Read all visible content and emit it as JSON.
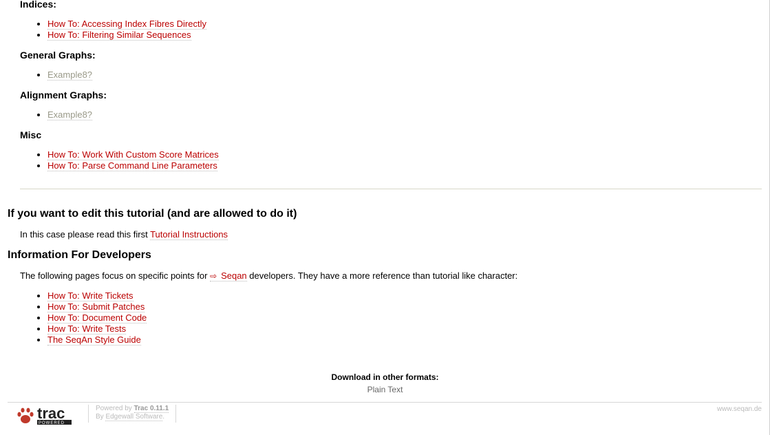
{
  "sections": {
    "indices": {
      "heading": "Indices:",
      "links": [
        "How To: Accessing Index Fibres Directly",
        "How To: Filtering Similar Sequences"
      ]
    },
    "general_graphs": {
      "heading": "General Graphs:",
      "links": [
        "Example8?"
      ]
    },
    "alignment_graphs": {
      "heading": "Alignment Graphs:",
      "links": [
        "Example8?"
      ]
    },
    "misc": {
      "heading": "Misc",
      "links": [
        "How To: Work With Custom Score Matrices",
        "How To: Parse Command Line Parameters"
      ]
    }
  },
  "edit": {
    "heading": "If you want to edit this tutorial (and are allowed to do it)",
    "text": "In this case please read this first",
    "link": "Tutorial Instructions"
  },
  "developers": {
    "heading": "Information For Developers",
    "text_before": "The following pages focus on specific points for",
    "ext_link": "Seqan",
    "text_after": "developers. They have a more reference than tutorial like character:",
    "links": [
      "How To: Write Tickets",
      "How To: Submit Patches",
      "How To: Document Code",
      "How To: Write Tests",
      "The SeqAn Style Guide"
    ]
  },
  "download": {
    "heading": "Download in other formats:",
    "plain_text": "Plain Text"
  },
  "footer": {
    "logo_text": "trac",
    "logo_sub": "POWERED",
    "powered_by": "Powered by",
    "trac_version": "Trac 0.11.1",
    "by": "By",
    "company": "Edgewall Software",
    "site": "www.seqan.de"
  },
  "colors": {
    "link": "#bb0000",
    "missing_link": "#999988"
  },
  "icons": {
    "external_link": "external-link-icon",
    "logo": "trac-paw-logo"
  }
}
